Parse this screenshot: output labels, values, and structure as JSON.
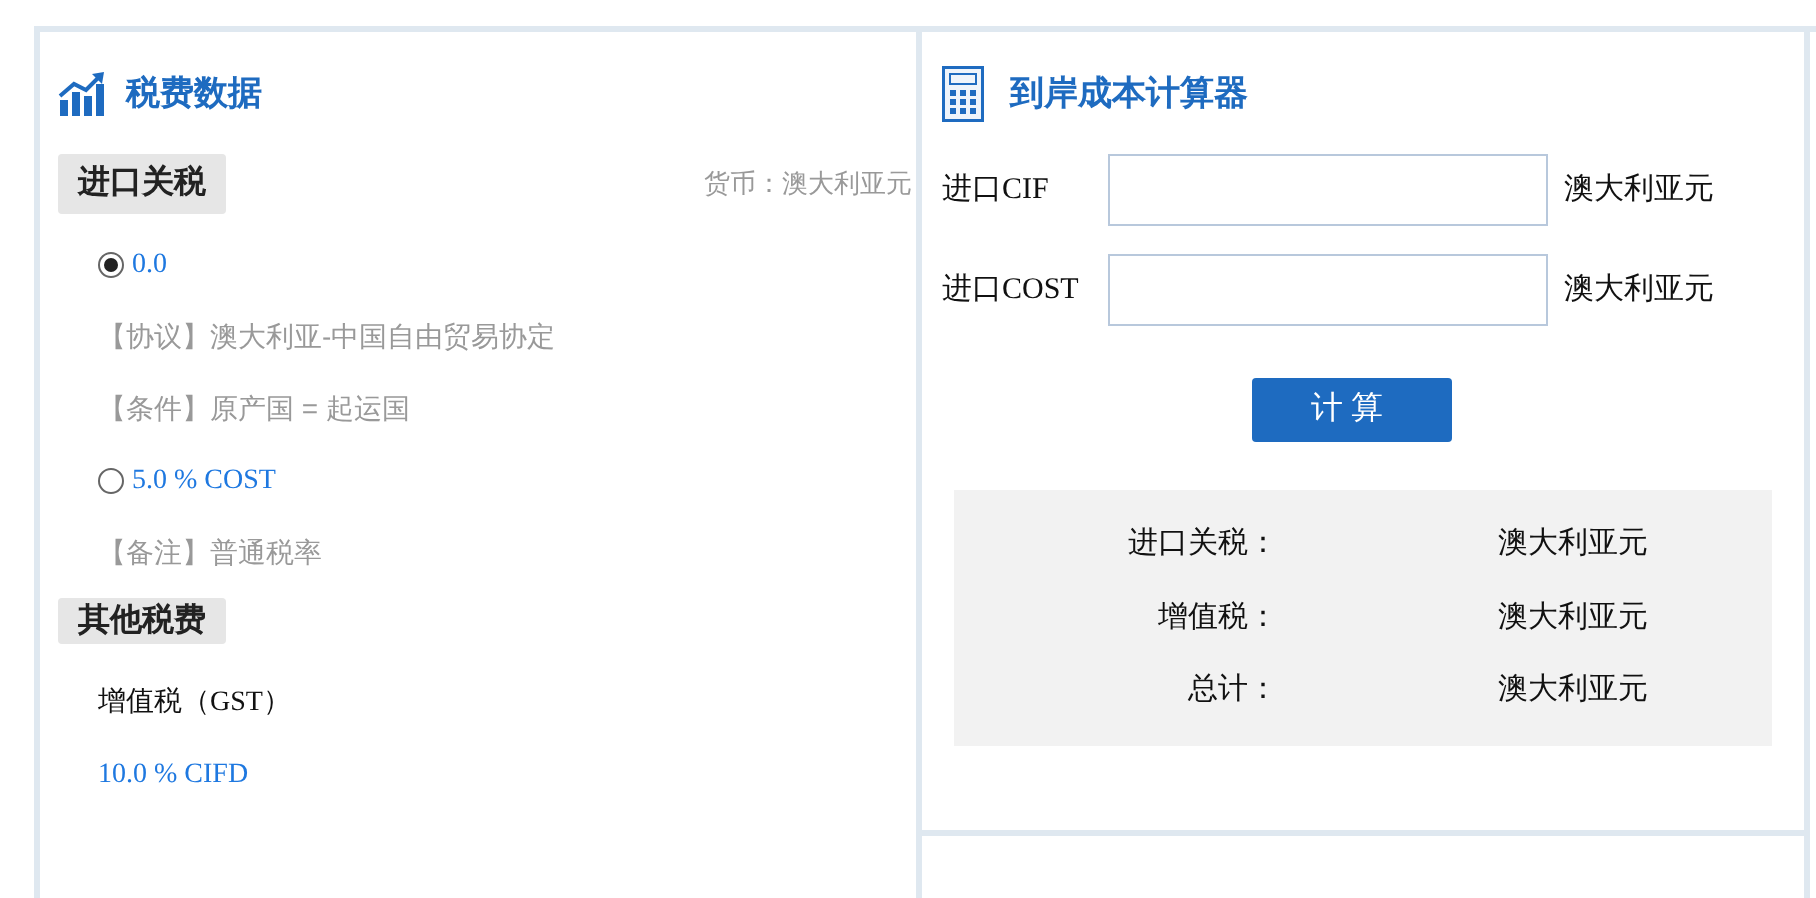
{
  "tax_panel": {
    "title": "税费数据",
    "import_duty": {
      "heading": "进口关税",
      "currency": "货币：澳大利亚元",
      "options": [
        {
          "rate": "0.0",
          "selected": true,
          "notes": [
            "【协议】澳大利亚-中国自由贸易协定",
            "【条件】原产国 = 起运国"
          ]
        },
        {
          "rate": "5.0 % COST",
          "selected": false,
          "notes": [
            "【备注】普通税率"
          ]
        }
      ]
    },
    "other_taxes": {
      "heading": "其他税费",
      "items": [
        {
          "name": "增值税（GST）",
          "rate": "10.0 % CIFD"
        }
      ]
    }
  },
  "calculator": {
    "title": "到岸成本计算器",
    "fields": [
      {
        "label": "进口CIF",
        "unit": "澳大利亚元"
      },
      {
        "label": "进口COST",
        "unit": "澳大利亚元"
      }
    ],
    "button": "计算",
    "results": [
      {
        "label": "进口关税：",
        "value": "澳大利亚元"
      },
      {
        "label": "增值税：",
        "value": "澳大利亚元"
      },
      {
        "label": "总计：",
        "value": "澳大利亚元"
      }
    ]
  }
}
